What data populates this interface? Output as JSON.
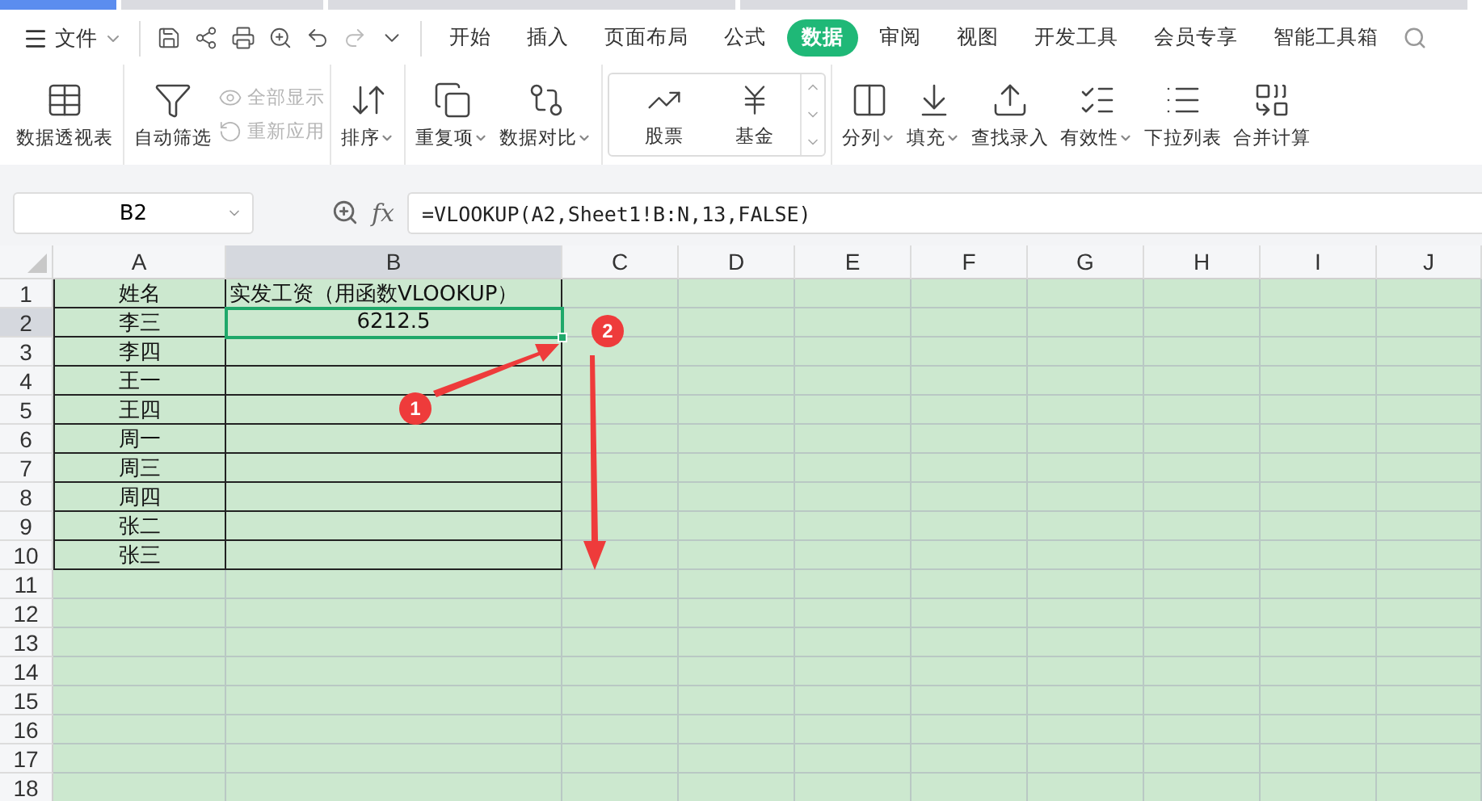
{
  "menu": {
    "label": "文件"
  },
  "tabs": [
    {
      "label": "开始",
      "selected": false
    },
    {
      "label": "插入",
      "selected": false
    },
    {
      "label": "页面布局",
      "selected": false
    },
    {
      "label": "公式",
      "selected": false
    },
    {
      "label": "数据",
      "selected": true
    },
    {
      "label": "审阅",
      "selected": false
    },
    {
      "label": "视图",
      "selected": false
    },
    {
      "label": "开发工具",
      "selected": false
    },
    {
      "label": "会员专享",
      "selected": false
    },
    {
      "label": "智能工具箱",
      "selected": false
    }
  ],
  "ribbon": [
    {
      "items": [
        {
          "kind": "large",
          "label": "数据透视表",
          "dropdown": false,
          "disabled": false
        }
      ]
    },
    {
      "items": [
        {
          "kind": "large",
          "label": "自动筛选",
          "dropdown": false,
          "disabled": false
        },
        {
          "kind": "small",
          "label": "全部显示",
          "dropdown": false,
          "disabled": true
        },
        {
          "kind": "small",
          "label": "重新应用",
          "dropdown": false,
          "disabled": true
        }
      ]
    },
    {
      "items": [
        {
          "kind": "large",
          "label": "排序",
          "dropdown": true,
          "disabled": false
        }
      ]
    },
    {
      "items": [
        {
          "kind": "large",
          "label": "重复项",
          "dropdown": true,
          "disabled": false
        },
        {
          "kind": "large",
          "label": "数据对比",
          "dropdown": true,
          "disabled": false
        }
      ]
    },
    {
      "items": [
        {
          "kind": "gallery",
          "label": "股票",
          "dropdown": false,
          "disabled": false
        },
        {
          "kind": "gallery",
          "label": "基金",
          "dropdown": false,
          "disabled": false
        }
      ]
    },
    {
      "items": [
        {
          "kind": "large",
          "label": "分列",
          "dropdown": true,
          "disabled": false
        },
        {
          "kind": "large",
          "label": "填充",
          "dropdown": true,
          "disabled": false
        },
        {
          "kind": "large",
          "label": "查找录入",
          "dropdown": false,
          "disabled": false
        },
        {
          "kind": "large",
          "label": "有效性",
          "dropdown": true,
          "disabled": false
        },
        {
          "kind": "large",
          "label": "下拉列表",
          "dropdown": false,
          "disabled": false
        },
        {
          "kind": "large",
          "label": "合并计算",
          "dropdown": false,
          "disabled": false
        }
      ]
    }
  ],
  "formula_bar": {
    "name_box": "B2",
    "fx_label": "fx",
    "formula": "=VLOOKUP(A2,Sheet1!B:N,13,FALSE)"
  },
  "sheet": {
    "columns": [
      {
        "label": "A",
        "selected": false
      },
      {
        "label": "B",
        "selected": true
      },
      {
        "label": "C",
        "selected": false
      },
      {
        "label": "D",
        "selected": false
      },
      {
        "label": "E",
        "selected": false
      },
      {
        "label": "F",
        "selected": false
      },
      {
        "label": "G",
        "selected": false
      },
      {
        "label": "H",
        "selected": false
      },
      {
        "label": "I",
        "selected": false
      },
      {
        "label": "J",
        "selected": false
      }
    ],
    "rows": [
      {
        "number": "1",
        "selected": false,
        "bordered": true,
        "cells": [
          {
            "text": "姓名",
            "selected": false
          },
          {
            "text": "实发工资（用函数VLOOKUP）",
            "selected": false
          }
        ]
      },
      {
        "number": "2",
        "selected": true,
        "bordered": true,
        "cells": [
          {
            "text": "李三",
            "selected": false
          },
          {
            "text": "6212.5",
            "selected": true
          }
        ]
      },
      {
        "number": "3",
        "selected": false,
        "bordered": true,
        "cells": [
          {
            "text": "李四",
            "selected": false
          }
        ]
      },
      {
        "number": "4",
        "selected": false,
        "bordered": true,
        "cells": [
          {
            "text": "王一",
            "selected": false
          }
        ]
      },
      {
        "number": "5",
        "selected": false,
        "bordered": true,
        "cells": [
          {
            "text": "王四",
            "selected": false
          }
        ]
      },
      {
        "number": "6",
        "selected": false,
        "bordered": true,
        "cells": [
          {
            "text": "周一",
            "selected": false
          }
        ]
      },
      {
        "number": "7",
        "selected": false,
        "bordered": true,
        "cells": [
          {
            "text": "周三",
            "selected": false
          }
        ]
      },
      {
        "number": "8",
        "selected": false,
        "bordered": true,
        "cells": [
          {
            "text": "周四",
            "selected": false
          }
        ]
      },
      {
        "number": "9",
        "selected": false,
        "bordered": true,
        "cells": [
          {
            "text": "张二",
            "selected": false
          }
        ]
      },
      {
        "number": "10",
        "selected": false,
        "bordered": true,
        "cells": [
          {
            "text": "张三",
            "selected": false
          }
        ]
      },
      {
        "number": "11",
        "selected": false,
        "bordered": false
      },
      {
        "number": "12",
        "selected": false,
        "bordered": false
      },
      {
        "number": "13",
        "selected": false,
        "bordered": false
      },
      {
        "number": "14",
        "selected": false,
        "bordered": false
      },
      {
        "number": "15",
        "selected": false,
        "bordered": false
      },
      {
        "number": "16",
        "selected": false,
        "bordered": false
      },
      {
        "number": "17",
        "selected": false,
        "bordered": false
      },
      {
        "number": "18",
        "selected": false,
        "bordered": false
      }
    ]
  },
  "annotations": [
    {
      "label": "1"
    },
    {
      "label": "2"
    }
  ]
}
